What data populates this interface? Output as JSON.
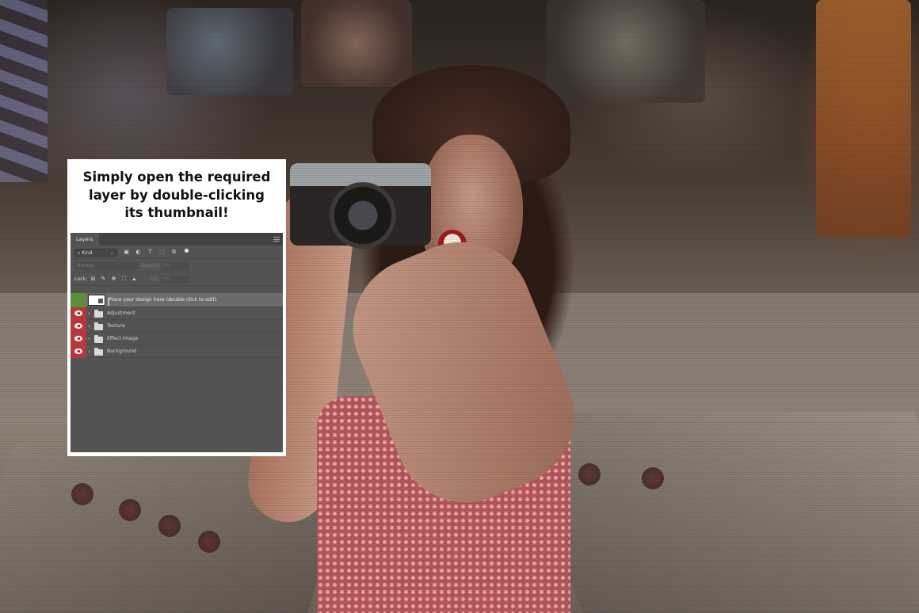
{
  "card": {
    "title_lines": [
      "Simply open the required",
      "layer by double-clicking",
      "its thumbnail!"
    ]
  },
  "layers_panel": {
    "tab_label": "Layers",
    "filter": {
      "kind_label": "Kind",
      "icons": [
        "image-filter-icon",
        "adjustment-filter-icon",
        "type-filter-icon",
        "shape-filter-icon",
        "smart-object-filter-icon"
      ]
    },
    "blend_mode": "Normal",
    "opacity_label": "Opacity:",
    "opacity_value": "0%",
    "lock_label": "Lock:",
    "lock_icons": [
      "lock-transparent-icon",
      "lock-brush-icon",
      "lock-move-icon",
      "lock-artboard-icon",
      "lock-all-icon"
    ],
    "fill_label": "Fill:",
    "fill_value": "0%",
    "layers": [
      {
        "name": "Place your design here (double click to edit)",
        "type": "smart-object",
        "visible": false,
        "selected": true
      },
      {
        "name": "Adjustment",
        "type": "group",
        "visible": true
      },
      {
        "name": "Texture",
        "type": "group",
        "visible": true
      },
      {
        "name": "Effect Image",
        "type": "group",
        "visible": true
      },
      {
        "name": "Background",
        "type": "group",
        "visible": true
      }
    ]
  },
  "colors": {
    "panel_bg": "#535353",
    "visibility_red": "#b5393c",
    "selected_green": "#5b8f3a"
  }
}
